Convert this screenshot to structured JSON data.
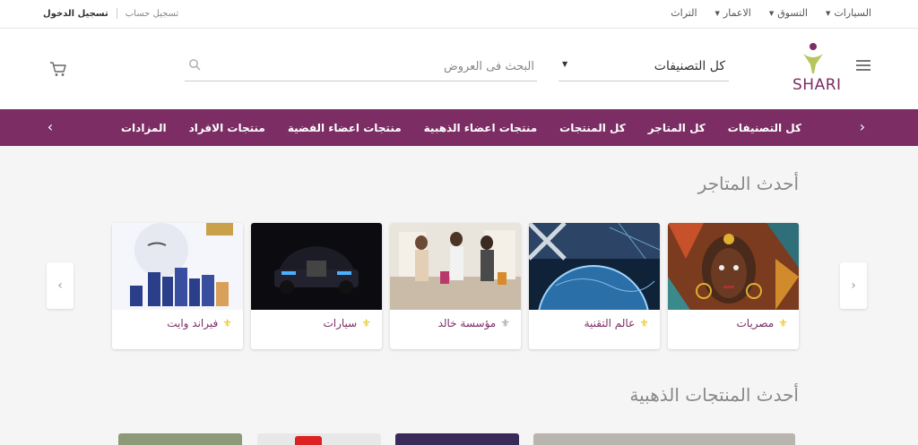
{
  "topbar": {
    "login": "تسجيل الدخول",
    "register": "تسجيل حساب",
    "menu": [
      {
        "label": "السيارات",
        "has_caret": true
      },
      {
        "label": "التسوق",
        "has_caret": true
      },
      {
        "label": "الاعمار",
        "has_caret": true
      },
      {
        "label": "التراث",
        "has_caret": false
      }
    ]
  },
  "header": {
    "logo_text": "SHARI",
    "category_select": {
      "value": "كل التصنيفات"
    },
    "search": {
      "placeholder": "البحث فى العروض",
      "value": ""
    },
    "icons": {
      "menu": "hamburger-icon",
      "search": "search-icon",
      "cart": "cart-icon"
    }
  },
  "nav": {
    "items": [
      "كل التصنيفات",
      "كل المتاجر",
      "كل المنتجات",
      "منتجات اعضاء الذهبية",
      "منتجات اعضاء الفضية",
      "منتجات الافراد",
      "المزادات"
    ]
  },
  "stores": {
    "title": "أحدث المتاجر",
    "items": [
      {
        "name": "مصريات"
      },
      {
        "name": "عالم التقنية"
      },
      {
        "name": "مؤسسة خالد"
      },
      {
        "name": "سيارات"
      },
      {
        "name": "فيراند وايت"
      }
    ]
  },
  "gold_products": {
    "title": "أحدث المنتجات الذهبية"
  },
  "colors": {
    "brand_purple": "#7b2d64",
    "badge_gold": "#e4c317",
    "background": "#f5f5f5"
  }
}
